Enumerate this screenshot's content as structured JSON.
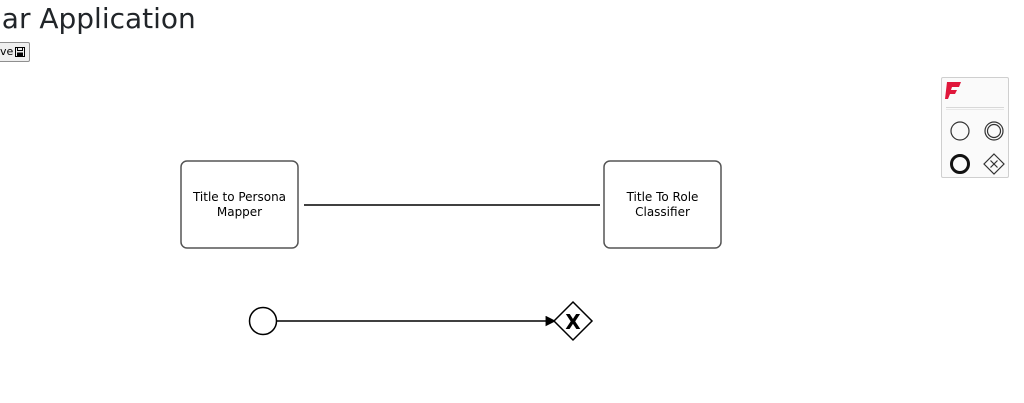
{
  "header": {
    "title": "lar Application"
  },
  "toolbar": {
    "save_label": "ve",
    "save_icon": "floppy-disk-icon"
  },
  "diagram": {
    "tasks": [
      {
        "name": "task-title-to-persona-mapper",
        "line1": "Title to Persona",
        "line2": "Mapper"
      },
      {
        "name": "task-title-to-role-classifier",
        "line1": "Title To Role",
        "line2": "Classifier"
      }
    ],
    "gateway_marker": "X"
  },
  "palette": {
    "logo": "camunda-logo-icon",
    "tools": [
      "start-event-icon",
      "intermediate-event-icon",
      "end-event-icon",
      "gateway-icon"
    ],
    "logo_color": "#e0173b"
  }
}
